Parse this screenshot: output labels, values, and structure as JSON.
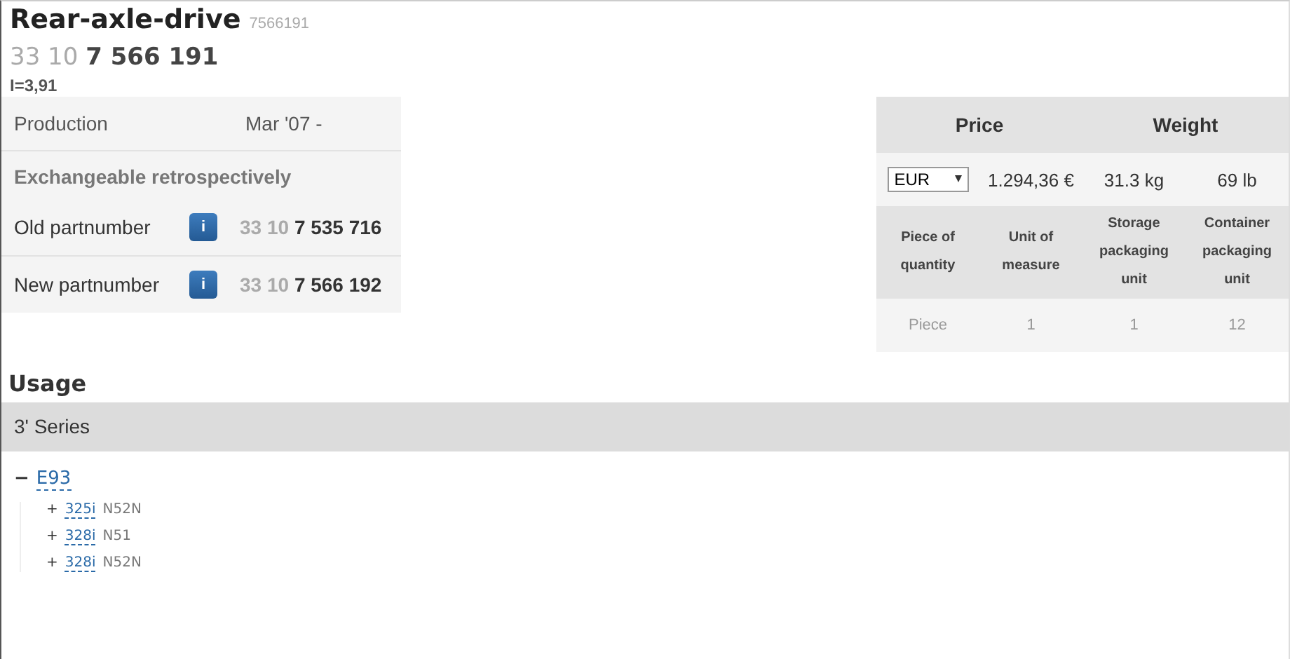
{
  "title": "Rear-axle-drive",
  "title_number": "7566191",
  "part_number": {
    "prefix": "33 10",
    "main": "7 566 191"
  },
  "note": "I=3,91",
  "production": {
    "label": "Production",
    "value": "Mar '07 -"
  },
  "exchange": {
    "heading": "Exchangeable retrospectively",
    "items": [
      {
        "label": "Old partnumber",
        "icon": "i",
        "prefix": "33 10",
        "main": "7 535 716"
      },
      {
        "label": "New partnumber",
        "icon": "i",
        "prefix": "33 10",
        "main": "7 566 192"
      }
    ]
  },
  "price_table": {
    "headers": [
      "Price",
      "Weight"
    ],
    "currency": "EUR",
    "price": "1.294,36 €",
    "weight_kg": "31.3 kg",
    "weight_lb": "69 lb",
    "columns": [
      "Piece of quantity",
      "Unit of measure",
      "Storage packaging unit",
      "Container packaging unit"
    ],
    "row": [
      "Piece",
      "1",
      "1",
      "12"
    ]
  },
  "usage": {
    "heading": "Usage",
    "series": "3' Series",
    "tree": [
      {
        "toggle": "−",
        "label": "E93",
        "expanded": true,
        "children": [
          {
            "toggle": "+",
            "label": "325i",
            "engine": "N52N",
            "expanded": false
          },
          {
            "toggle": "+",
            "label": "328i",
            "engine": "N51",
            "expanded": false
          },
          {
            "toggle": "+",
            "label": "328i",
            "engine": "N52N",
            "expanded": false
          }
        ]
      }
    ]
  }
}
